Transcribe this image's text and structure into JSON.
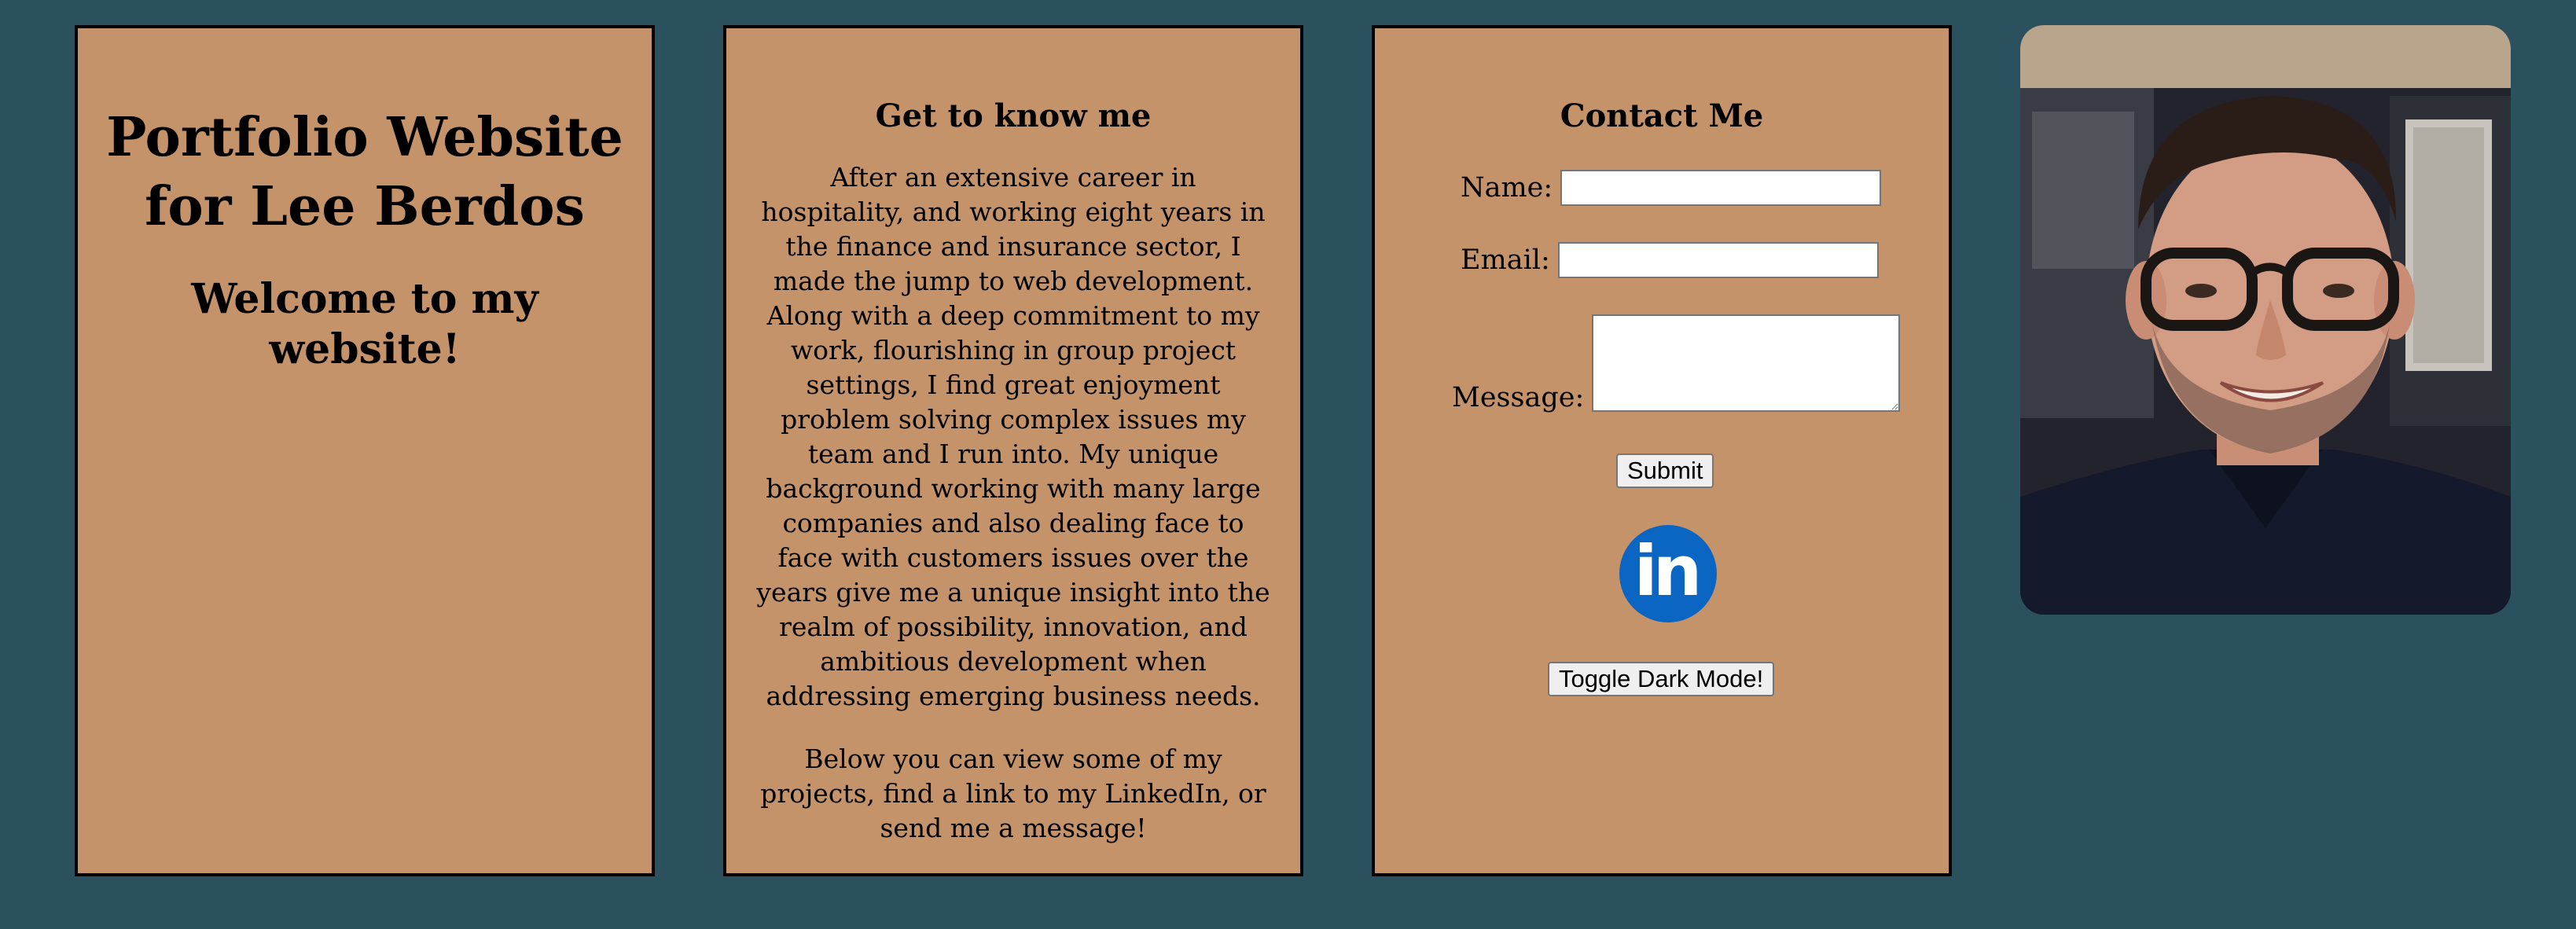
{
  "title_card": {
    "title": "Portfolio Website for Lee Berdos",
    "welcome": "Welcome to my website!"
  },
  "about": {
    "heading": "Get to know me",
    "paragraph1": "After an extensive career in hospitality, and working eight years in the finance and insurance sector, I made the jump to web development. Along with a deep commitment to my work, flourishing in group project settings, I find great enjoyment problem solving complex issues my team and I run into. My unique background working with many large companies and also dealing face to face with customers issues over the years give me a unique insight into the realm of possibility, innovation, and ambitious development when addressing emerging business needs.",
    "paragraph2": "Below you can view some of my projects, find a link to my LinkedIn, or send me a message!"
  },
  "contact": {
    "heading": "Contact Me",
    "name_label": "Name:",
    "name_value": "",
    "email_label": "Email:",
    "email_value": "",
    "message_label": "Message:",
    "message_value": "",
    "submit_label": "Submit",
    "linkedin_icon": "linkedin-icon",
    "linkedin_text": "in",
    "dark_mode_label": "Toggle Dark Mode!"
  },
  "colors": {
    "page_background": "#2b515e",
    "card_background": "#c59369",
    "linkedin_blue": "#0a66c2"
  },
  "photo": {
    "alt": "profile-photo"
  }
}
